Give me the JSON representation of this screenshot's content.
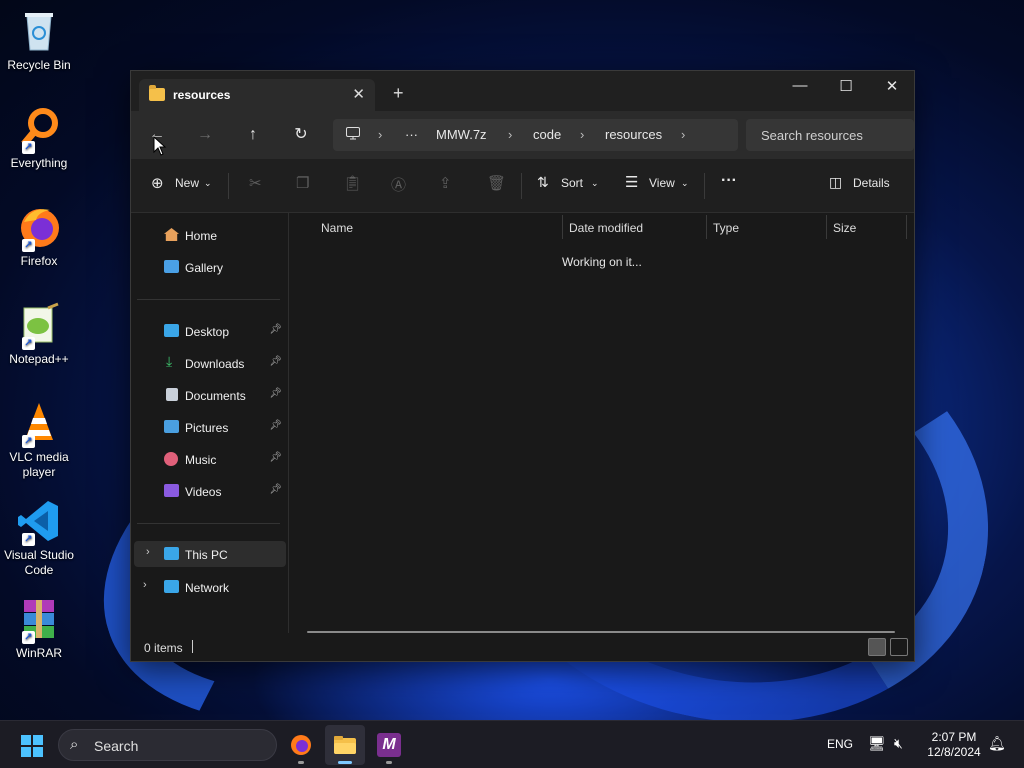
{
  "desktop": {
    "icons": [
      {
        "label": "Recycle Bin"
      },
      {
        "label": "Everything"
      },
      {
        "label": "Firefox"
      },
      {
        "label": "Notepad++"
      },
      {
        "label": "VLC media player"
      },
      {
        "label": "Visual Studio Code"
      },
      {
        "label": "WinRAR"
      }
    ]
  },
  "window": {
    "tab_title": "resources",
    "tab_close": "✕",
    "new_tab": "+",
    "controls": {
      "minimize": "—",
      "maximize": "☐",
      "close": "✕"
    },
    "nav": {
      "back": "←",
      "forward": "→",
      "up": "↑",
      "refresh": "↻"
    },
    "breadcrumb": [
      "MMW.7z",
      "code",
      "resources"
    ],
    "breadcrumb_more": "···",
    "search_placeholder": "Search resources",
    "commands": {
      "new": "New",
      "sort": "Sort",
      "view": "View",
      "more": "···",
      "details": "Details"
    },
    "sidebar": {
      "top": [
        {
          "label": "Home",
          "color": "#e8a15c"
        },
        {
          "label": "Gallery",
          "color": "#4aa0e6"
        }
      ],
      "pinned": [
        {
          "label": "Desktop",
          "color": "#3aa6e8"
        },
        {
          "label": "Downloads",
          "color": "#3ec46d"
        },
        {
          "label": "Documents",
          "color": "#c9d0da"
        },
        {
          "label": "Pictures",
          "color": "#4a9fe0"
        },
        {
          "label": "Music",
          "color": "#e0607a"
        },
        {
          "label": "Videos",
          "color": "#8a5ae0"
        }
      ],
      "drives": [
        {
          "label": "This PC",
          "color": "#3aa6e8"
        },
        {
          "label": "Network",
          "color": "#3aa6e8"
        }
      ]
    },
    "columns": [
      "Name",
      "Date modified",
      "Type",
      "Size"
    ],
    "loading_text": "Working on it...",
    "status": {
      "item_count": "0 items"
    }
  },
  "taskbar": {
    "search_label": "Search",
    "language": "ENG",
    "time": "2:07 PM",
    "date": "12/8/2024"
  }
}
